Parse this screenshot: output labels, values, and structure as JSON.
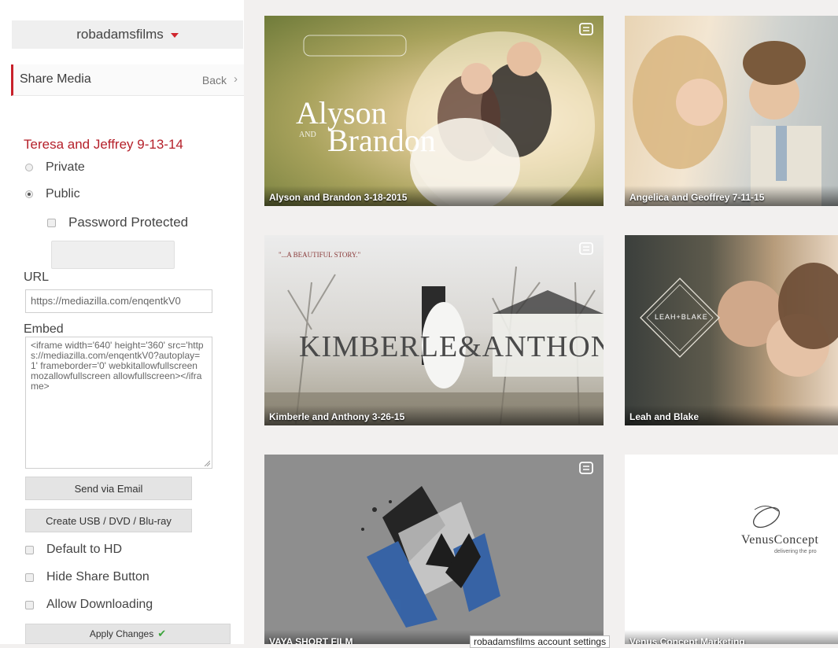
{
  "account": {
    "name": "robadamsfilms"
  },
  "share_header": {
    "title": "Share Media",
    "back_label": "Back"
  },
  "media": {
    "title": "Teresa and Jeffrey 9-13-14"
  },
  "privacy": {
    "private_label": "Private",
    "public_label": "Public",
    "selected": "Public",
    "password_label": "Password Protected",
    "password_checked": false
  },
  "url": {
    "label": "URL",
    "value": "https://mediazilla.com/enqentkV0"
  },
  "embed": {
    "label": "Embed",
    "value": "<iframe width='640' height='360' src='https://mediazilla.com/enqentkV0?autoplay=1' frameborder='0' webkitallowfullscreen mozallowfullscreen allowfullscreen></iframe>"
  },
  "buttons": {
    "send_email": "Send via Email",
    "create_media": "Create USB / DVD / Blu-ray",
    "apply": "Apply Changes"
  },
  "options": {
    "default_hd": "Default to HD",
    "hide_share": "Hide Share Button",
    "allow_download": "Allow Downloading"
  },
  "tiles": [
    {
      "caption": "Alyson and Brandon 3-18-2015",
      "art_line1": "Alyson",
      "art_line2": "Brandon",
      "art_and": "AND"
    },
    {
      "caption": "Angelica and Geoffrey 7-11-15"
    },
    {
      "caption": "Kimberle and Anthony 3-26-15",
      "art_main": "KIMBERLE&ANTHONY",
      "art_top": "\"...A BEAUTIFUL STORY.\""
    },
    {
      "caption": "Leah and Blake",
      "art_badge": "LEAH+BLAKE"
    },
    {
      "caption": "VAYA SHORT FILM"
    },
    {
      "caption": "Venus Concept Marketing",
      "art_logo": "VenusConcept",
      "art_tagline": "delivering the pro"
    }
  ],
  "tooltip": "robadamsfilms account settings",
  "colors": {
    "accent": "#c8202a",
    "success": "#3aa33a"
  }
}
